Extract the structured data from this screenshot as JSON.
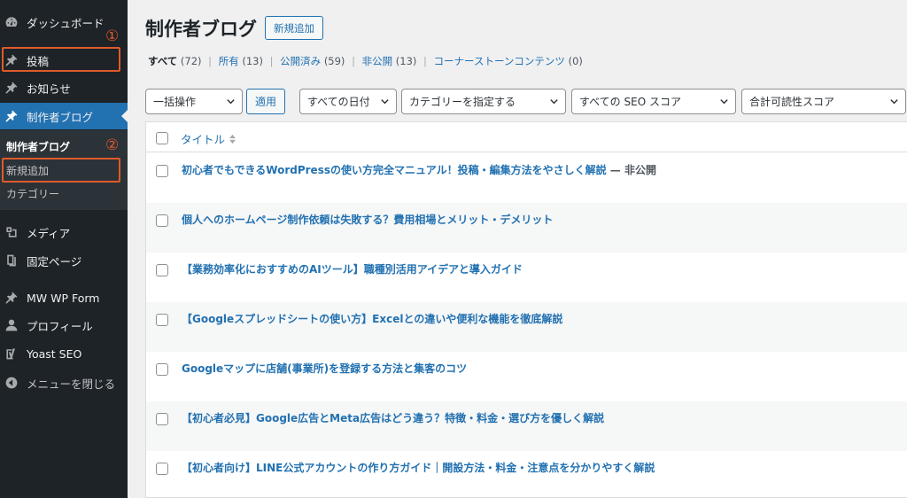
{
  "sidebar": {
    "items": [
      {
        "label": "ダッシュボード",
        "icon": "dashboard-icon"
      },
      {
        "label": "投稿",
        "icon": "pin-icon"
      },
      {
        "label": "お知らせ",
        "icon": "pin-icon"
      },
      {
        "label": "制作者ブログ",
        "icon": "pin-icon",
        "active": true
      },
      {
        "label": "メディア",
        "icon": "media-icon"
      },
      {
        "label": "固定ページ",
        "icon": "page-icon"
      },
      {
        "label": "MW WP Form",
        "icon": "pin-icon"
      },
      {
        "label": "プロフィール",
        "icon": "user-icon"
      },
      {
        "label": "Yoast SEO",
        "icon": "yoast-icon"
      },
      {
        "label": "メニューを閉じる",
        "icon": "collapse-icon"
      }
    ],
    "submenu": [
      {
        "label": "制作者ブログ",
        "current": true
      },
      {
        "label": "新規追加"
      },
      {
        "label": "カテゴリー"
      }
    ],
    "annotations": [
      "①",
      "②"
    ]
  },
  "header": {
    "title": "制作者ブログ",
    "add_new_label": "新規追加"
  },
  "filters": {
    "status_links": [
      {
        "label": "すべて",
        "count": "(72)"
      },
      {
        "label": "所有",
        "count": "(13)"
      },
      {
        "label": "公開済み",
        "count": "(59)"
      },
      {
        "label": "非公開",
        "count": "(13)"
      },
      {
        "label": "コーナーストーンコンテンツ",
        "count": "(0)"
      }
    ],
    "separator": "|",
    "bulk_action": "一括操作",
    "apply_label": "適用",
    "date_filter": "すべての日付",
    "category_filter": "カテゴリーを指定する",
    "seo_filter": "すべての SEO スコア",
    "readability_filter": "合計可読性スコア"
  },
  "table": {
    "column_title": "タイトル",
    "rows": [
      {
        "title": "初心者でもできるWordPressの使い方完全マニュアル！投稿・編集方法をやさしく解説",
        "state": " — 非公開"
      },
      {
        "title": "個人へのホームページ制作依頼は失敗する？費用相場とメリット・デメリット",
        "state": ""
      },
      {
        "title": "【業務効率化におすすめのAIツール】職種別活用アイデアと導入ガイド",
        "state": ""
      },
      {
        "title": "【Googleスプレッドシートの使い方】Excelとの違いや便利な機能を徹底解説",
        "state": ""
      },
      {
        "title": "Googleマップに店舗(事業所)を登録する方法と集客のコツ",
        "state": ""
      },
      {
        "title": "【初心者必見】Google広告とMeta広告はどう違う？特徴・料金・選び方を優しく解説",
        "state": ""
      },
      {
        "title": "【初心者向け】LINE公式アカウントの作り方ガイド｜開設方法・料金・注意点を分かりやすく解説",
        "state": ""
      }
    ]
  },
  "colors": {
    "sidebar_bg": "#1d2327",
    "active_bg": "#2271b1",
    "link": "#2271b1",
    "annotation": "#e05a2b"
  }
}
